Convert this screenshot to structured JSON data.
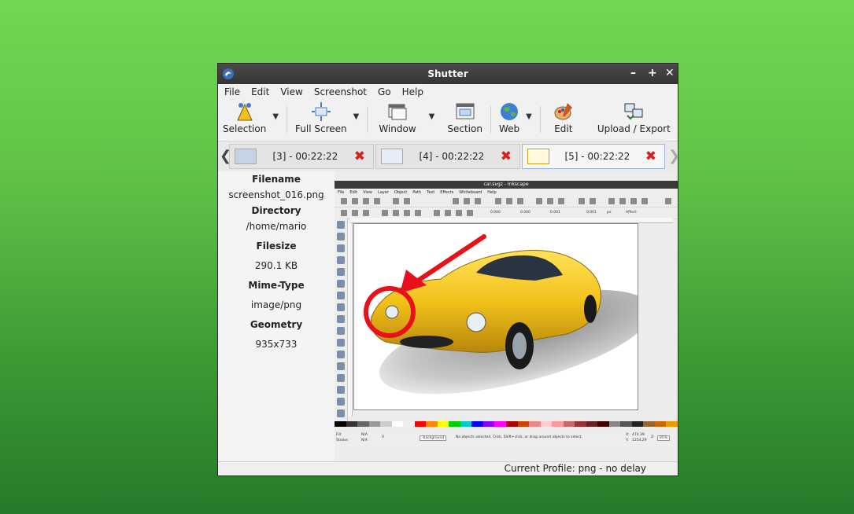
{
  "window": {
    "title": "Shutter",
    "minimize": "–",
    "maximize": "+",
    "close": "✕"
  },
  "menu": [
    "File",
    "Edit",
    "View",
    "Screenshot",
    "Go",
    "Help"
  ],
  "toolbar": {
    "selection": "Selection",
    "full_screen": "Full Screen",
    "window": "Window",
    "section": "Section",
    "web": "Web",
    "edit": "Edit",
    "upload": "Upload / Export"
  },
  "tabs": [
    {
      "label": "[3] - 00:22:22"
    },
    {
      "label": "[4] - 00:22:22"
    },
    {
      "label": "[5] - 00:22:22"
    }
  ],
  "info": {
    "filename_label": "Filename",
    "filename": "screenshot_016.png",
    "directory_label": "Directory",
    "directory": "/home/mario",
    "filesize_label": "Filesize",
    "filesize": "290.1 KB",
    "mime_label": "Mime-Type",
    "mime": "image/png",
    "geometry_label": "Geometry",
    "geometry": "935x733"
  },
  "status": "Current Profile: png - no delay",
  "inkscape": {
    "title": "car.svgz - Inkscape",
    "menu": [
      "File",
      "Edit",
      "View",
      "Layer",
      "Object",
      "Path",
      "Text",
      "Effects",
      "Whiteboard",
      "Help"
    ],
    "status_msg": "No objects selected. Click, Shift+click, or drag around objects to select.",
    "layer": "-background",
    "zoom": "85%",
    "fill_label": "Fill:",
    "stroke_label": "Stroke:",
    "na": "N/A",
    "x_label": "X:",
    "x_value": "474.39",
    "y_label": "Y:",
    "y_value": "1254.29",
    "z_label": "Z:",
    "opacity": "0",
    "affect": "Affect:",
    "unit": "px",
    "coords": [
      "0.000",
      "0.000",
      "0.001",
      "0.001"
    ]
  },
  "colors": {
    "accent": "#d62020",
    "car": "#f2c21a",
    "annotation": "#e8101a"
  },
  "icons": {
    "app": "shutter-icon",
    "selection": "selection-icon",
    "full_screen": "fullscreen-icon",
    "window": "window-icon",
    "section": "section-icon",
    "web": "globe-icon",
    "edit": "edit-palette-icon",
    "upload": "upload-export-icon",
    "close_tab": "close-icon"
  }
}
